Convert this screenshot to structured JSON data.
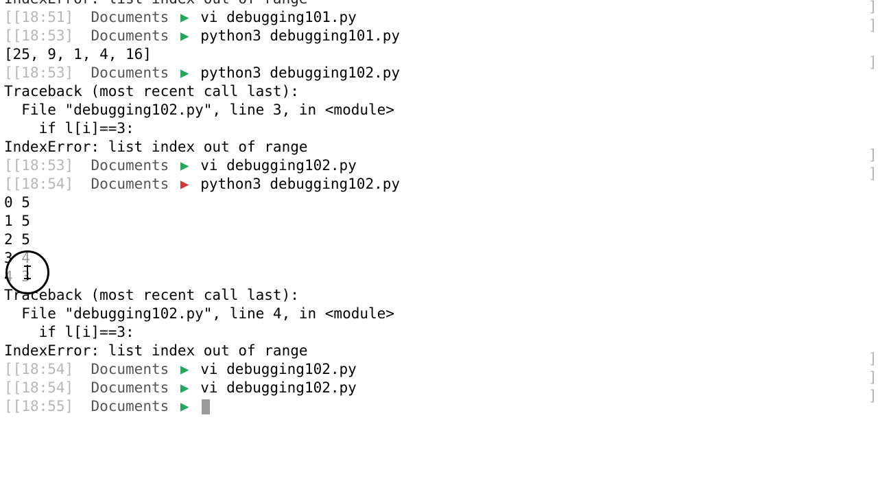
{
  "lines": [
    {
      "type": "out",
      "text": "IndexError: list index out of range",
      "partial_top": true
    },
    {
      "type": "prompt",
      "time": "18:51",
      "dir": "Documents",
      "arrow": "green",
      "cmd": "vi debugging101.py",
      "trail": true
    },
    {
      "type": "prompt",
      "time": "18:53",
      "dir": "Documents",
      "arrow": "green",
      "cmd": "python3 debugging101.py",
      "trail": true
    },
    {
      "type": "out",
      "text": "[25, 9, 1, 4, 16]"
    },
    {
      "type": "prompt",
      "time": "18:53",
      "dir": "Documents",
      "arrow": "green",
      "cmd": "python3 debugging102.py",
      "trail": true
    },
    {
      "type": "out",
      "text": "Traceback (most recent call last):"
    },
    {
      "type": "out",
      "text": "  File \"debugging102.py\", line 3, in <module>"
    },
    {
      "type": "out",
      "text": "    if l[i]==3:"
    },
    {
      "type": "out",
      "text": "IndexError: list index out of range"
    },
    {
      "type": "prompt",
      "time": "18:53",
      "dir": "Documents",
      "arrow": "green",
      "cmd": "vi debugging102.py",
      "trail": true
    },
    {
      "type": "prompt",
      "time": "18:54",
      "dir": "Documents",
      "arrow": "red",
      "cmd": "python3 debugging102.py",
      "trail": true
    },
    {
      "type": "out",
      "text": "0 5"
    },
    {
      "type": "out",
      "text": "1 5"
    },
    {
      "type": "out",
      "text": "2 5"
    },
    {
      "type": "out",
      "text": "3 4"
    },
    {
      "type": "out",
      "text": "4 3"
    },
    {
      "type": "out",
      "text": "Traceback (most recent call last):"
    },
    {
      "type": "out",
      "text": "  File \"debugging102.py\", line 4, in <module>"
    },
    {
      "type": "out",
      "text": "    if l[i]==3:"
    },
    {
      "type": "out",
      "text": "IndexError: list index out of range"
    },
    {
      "type": "prompt",
      "time": "18:54",
      "dir": "Documents",
      "arrow": "green",
      "cmd": "vi debugging102.py",
      "trail": true
    },
    {
      "type": "prompt",
      "time": "18:54",
      "dir": "Documents",
      "arrow": "green",
      "cmd": "vi debugging102.py",
      "trail": true
    },
    {
      "type": "prompt",
      "time": "18:55",
      "dir": "Documents",
      "arrow": "green",
      "cmd": "",
      "cursor": true,
      "trail": true
    }
  ],
  "glyphs": {
    "arrow": "▶",
    "right_bracket": "]"
  }
}
